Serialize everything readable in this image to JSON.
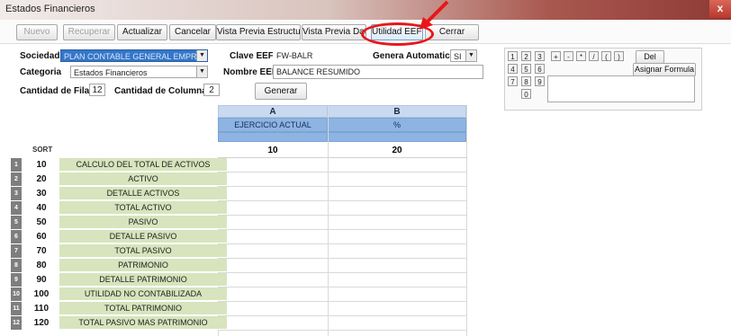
{
  "window": {
    "title": "Estados Financieros",
    "close_glyph": "x"
  },
  "toolbar": {
    "buttons": [
      {
        "label": "Nuevo"
      },
      {
        "label": "Recuperar"
      },
      {
        "label": "Actualizar"
      },
      {
        "label": "Cancelar"
      },
      {
        "label": "Vista Previa Estructura"
      },
      {
        "label": "Vista Previa Datos"
      },
      {
        "label": "Utilidad EEFF"
      },
      {
        "label": "Cerrar"
      }
    ]
  },
  "form": {
    "sociedad_label": "Sociedad",
    "sociedad_value": "PLAN CONTABLE GENERAL EMPRESARIAL",
    "categoria_label": "Categoria",
    "categoria_value": "Estados Financieros",
    "filas_label": "Cantidad de Filas",
    "filas_value": "12",
    "columnas_label": "Cantidad de Columnas",
    "columnas_value": "2",
    "clave_label": "Clave EEFF",
    "clave_value": "FW-BALR",
    "nombre_label": "Nombre EEFF",
    "nombre_value": "BALANCE RESUMIDO",
    "generar_label": "Generar",
    "genera_auto_label": "Genera Automatico",
    "genera_auto_value": "SI"
  },
  "keypad": {
    "digits": [
      "1",
      "2",
      "3",
      "4",
      "5",
      "6",
      "7",
      "8",
      "9",
      "0"
    ],
    "operators": [
      "+",
      "-",
      "*",
      "/",
      "(",
      ")"
    ],
    "del_label": "Del",
    "asignar_label": "Asignar Formula"
  },
  "grid": {
    "col_a": "A",
    "col_b": "B",
    "col_a_title": "EJERCICIO ACTUAL",
    "col_b_title": "%",
    "col_a_num": "10",
    "col_b_num": "20",
    "sort_header": "SORT",
    "rows": [
      {
        "n": "1",
        "sort": "10",
        "label": "CALCULO DEL TOTAL DE ACTIVOS"
      },
      {
        "n": "2",
        "sort": "20",
        "label": "ACTIVO"
      },
      {
        "n": "3",
        "sort": "30",
        "label": "DETALLE ACTIVOS"
      },
      {
        "n": "4",
        "sort": "40",
        "label": "TOTAL ACTIVO"
      },
      {
        "n": "5",
        "sort": "50",
        "label": "PASIVO"
      },
      {
        "n": "6",
        "sort": "60",
        "label": "DETALLE PASIVO"
      },
      {
        "n": "7",
        "sort": "70",
        "label": "TOTAL PASIVO"
      },
      {
        "n": "8",
        "sort": "80",
        "label": "PATRIMONIO"
      },
      {
        "n": "9",
        "sort": "90",
        "label": "DETALLE PATRIMONIO"
      },
      {
        "n": "10",
        "sort": "100",
        "label": "UTILIDAD NO CONTABILIZADA"
      },
      {
        "n": "11",
        "sort": "110",
        "label": "TOTAL PATRIMONIO"
      },
      {
        "n": "12",
        "sort": "120",
        "label": "TOTAL PASIVO MAS PATRIMONIO"
      }
    ]
  },
  "colors": {
    "accent_red": "#e8161a",
    "grid_header_blue": "#8db4e2",
    "row_green": "#d7e4bd",
    "select_blue": "#3476c9"
  }
}
